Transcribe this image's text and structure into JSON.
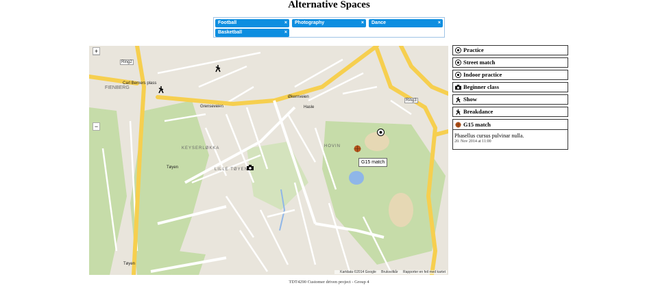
{
  "page": {
    "title": "Alternative Spaces",
    "footer": "TDT4290 Customer driven project - Group 4"
  },
  "filter_tags": [
    {
      "label": "Football",
      "remove": "×"
    },
    {
      "label": "Photography",
      "remove": "×"
    },
    {
      "label": "Dance",
      "remove": "×"
    },
    {
      "label": "Basketball",
      "remove": "×"
    }
  ],
  "map": {
    "zoom_in": "+",
    "zoom_out": "−",
    "attribution": "Kartdata ©2014 Google",
    "terms": "Bruksvilkår",
    "report": "Rapporter en feil med kartet",
    "tooltip": "G15 match",
    "labels": {
      "carl_berners": "Carl Berners plass",
      "hasle": "Hasle",
      "toyen": "Tøyen",
      "toyen_station": "Tøyen",
      "keyserlokka": "KEYSERLØKKA",
      "lille_toyen": "LILLE TØYEN",
      "hovin": "HOVIN",
      "grenseveien": "Grenseveien",
      "okernveien": "Økernveien",
      "ring2": "Ring2",
      "ring3": "Ring3",
      "fienberg": "FIENBERG"
    }
  },
  "categories": [
    {
      "label": "Practice",
      "icon": "soccer-ball-icon"
    },
    {
      "label": "Street match",
      "icon": "soccer-ball-icon"
    },
    {
      "label": "Indoor practice",
      "icon": "soccer-ball-icon"
    },
    {
      "label": "Beginner class",
      "icon": "camera-icon"
    },
    {
      "label": "Show",
      "icon": "dancer-icon"
    },
    {
      "label": "Breakdance",
      "icon": "dancer-icon"
    },
    {
      "label": "G15 match",
      "icon": "basketball-icon",
      "description": "Phasellus cursus pulvinar nulla.",
      "date": "20. Nov 2014 at 11:00"
    }
  ],
  "colors": {
    "tag_bg": "#0d8ee0",
    "tag_border": "#9ec3e6",
    "map_land": "#e9e5dc",
    "map_park": "#c6dca9",
    "map_road_major": "#f6cf4f",
    "map_water": "#8fb6e8"
  }
}
